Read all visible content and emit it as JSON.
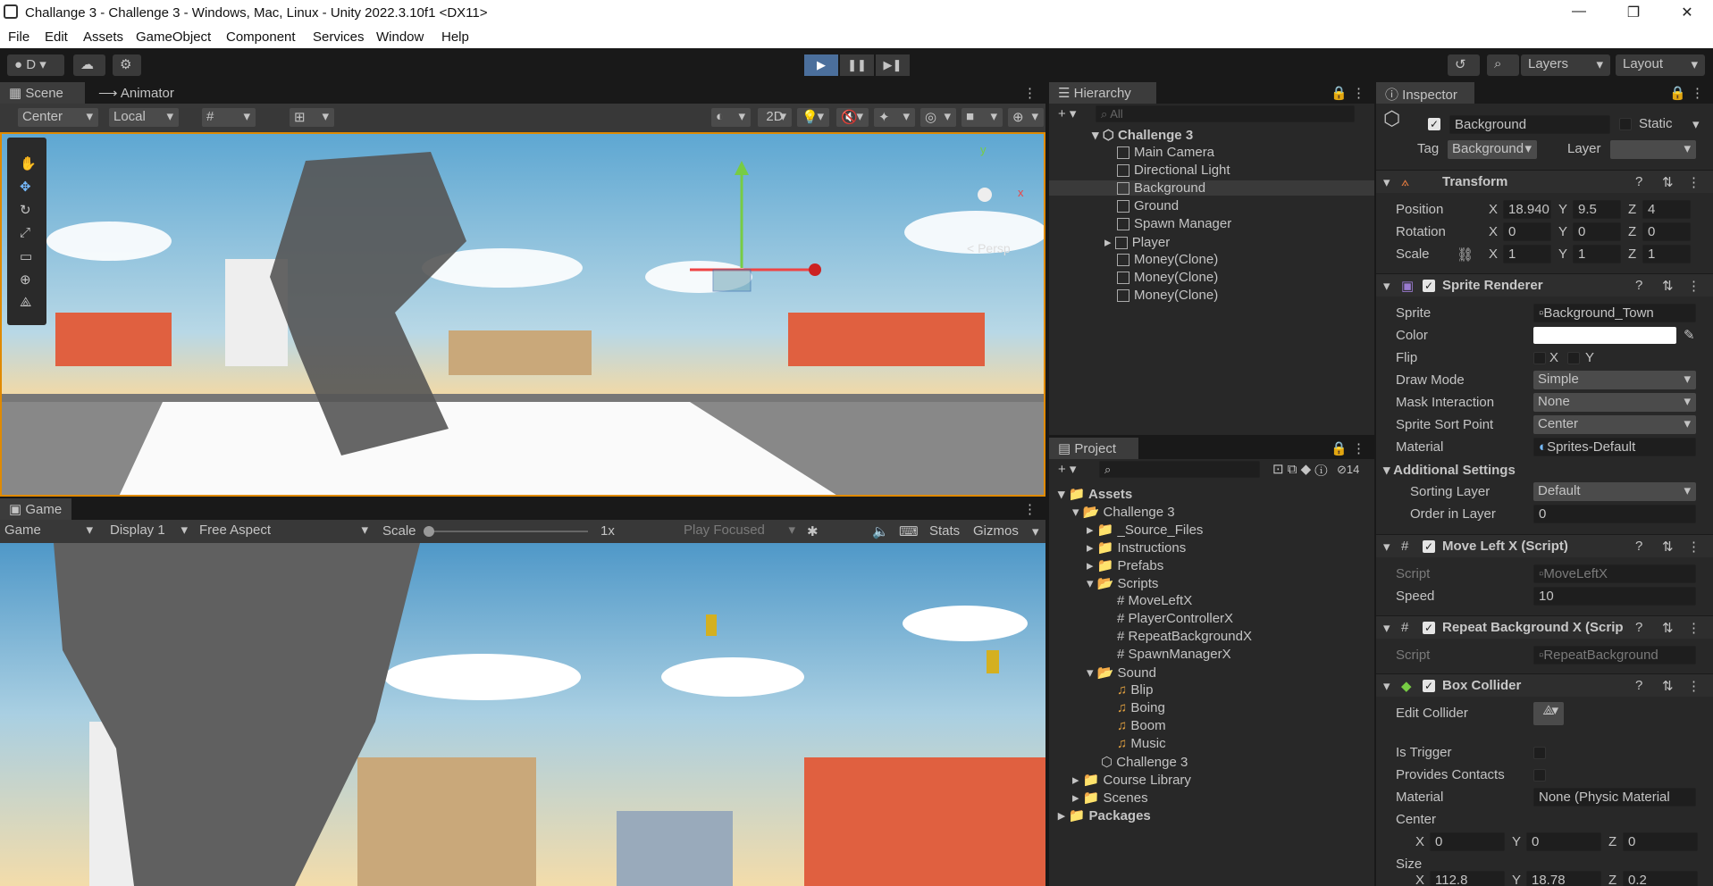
{
  "window": {
    "title": "Challange 3 - Challenge 3 - Windows, Mac, Linux - Unity 2022.3.10f1 <DX11>"
  },
  "menu": [
    "File",
    "Edit",
    "Assets",
    "GameObject",
    "Component",
    "Services",
    "Window",
    "Help"
  ],
  "toolbar": {
    "account": "D",
    "layers": "Layers",
    "layout": "Layout"
  },
  "scene": {
    "tabs": [
      "Scene",
      "Animator"
    ],
    "pivot": "Center",
    "space": "Local",
    "mode_2d": "2D",
    "persp": "< Persp",
    "gizmo_y": "y",
    "gizmo_x": "x"
  },
  "game": {
    "tab": "Game",
    "view": "Game",
    "display": "Display 1",
    "aspect": "Free Aspect",
    "scale_label": "Scale",
    "scale_value": "1x",
    "play_focused": "Play Focused",
    "stats": "Stats",
    "gizmos": "Gizmos"
  },
  "hierarchy": {
    "tab": "Hierarchy",
    "search_placeholder": "All",
    "items": [
      "Challenge 3",
      "Main Camera",
      "Directional Light",
      "Background",
      "Ground",
      "Spawn Manager",
      "Player",
      "Money(Clone)",
      "Money(Clone)",
      "Money(Clone)"
    ]
  },
  "project": {
    "tab": "Project",
    "hidden_count": "14",
    "tree": [
      "Assets",
      "Challenge 3",
      "_Source_Files",
      "Instructions",
      "Prefabs",
      "Scripts",
      "MoveLeftX",
      "PlayerControllerX",
      "RepeatBackgroundX",
      "SpawnManagerX",
      "Sound",
      "Blip",
      "Boing",
      "Boom",
      "Music",
      "Challenge 3",
      "Course Library",
      "Scenes",
      "Packages"
    ]
  },
  "inspector": {
    "tab": "Inspector",
    "object_name": "Background",
    "static_label": "Static",
    "tag_label": "Tag",
    "tag_value": "Background",
    "layer_label": "Layer",
    "layer_value": "",
    "transform": {
      "title": "Transform",
      "position_label": "Position",
      "rotation_label": "Rotation",
      "scale_label": "Scale",
      "pos": [
        "18.940",
        "9.5",
        "4"
      ],
      "rot": [
        "0",
        "0",
        "0"
      ],
      "scl": [
        "1",
        "1",
        "1"
      ]
    },
    "sprite_renderer": {
      "title": "Sprite Renderer",
      "sprite_label": "Sprite",
      "sprite": "Background_Town",
      "color_label": "Color",
      "color": "#ffffff",
      "flip_label": "Flip",
      "draw_mode_label": "Draw Mode",
      "draw_mode": "Simple",
      "mask_label": "Mask Interaction",
      "mask": "None",
      "sort_point_label": "Sprite Sort Point",
      "sort_point": "Center",
      "material_label": "Material",
      "material": "Sprites-Default",
      "additional": "Additional Settings",
      "sorting_layer_label": "Sorting Layer",
      "sorting_layer": "Default",
      "order_label": "Order in Layer",
      "order": "0"
    },
    "move_left": {
      "title": "Move Left X (Script)",
      "script_label": "Script",
      "script": "MoveLeftX",
      "speed_label": "Speed",
      "speed": "10"
    },
    "repeat_bg": {
      "title": "Repeat Background X (Scrip",
      "script_label": "Script",
      "script": "RepeatBackground"
    },
    "box_collider": {
      "title": "Box Collider",
      "edit_label": "Edit Collider",
      "trigger_label": "Is Trigger",
      "contacts_label": "Provides Contacts",
      "material_label": "Material",
      "material": "None (Physic Material",
      "center_label": "Center",
      "center": [
        "0",
        "0",
        "0"
      ],
      "size_label": "Size",
      "size": [
        "112.8",
        "18.78",
        "0.2"
      ]
    },
    "axis": [
      "X",
      "Y",
      "Z"
    ]
  },
  "colors": {
    "accent": "#4b6f9c",
    "sky_top": "#6fb0d6",
    "sky_bottom": "#f0d8a8"
  }
}
